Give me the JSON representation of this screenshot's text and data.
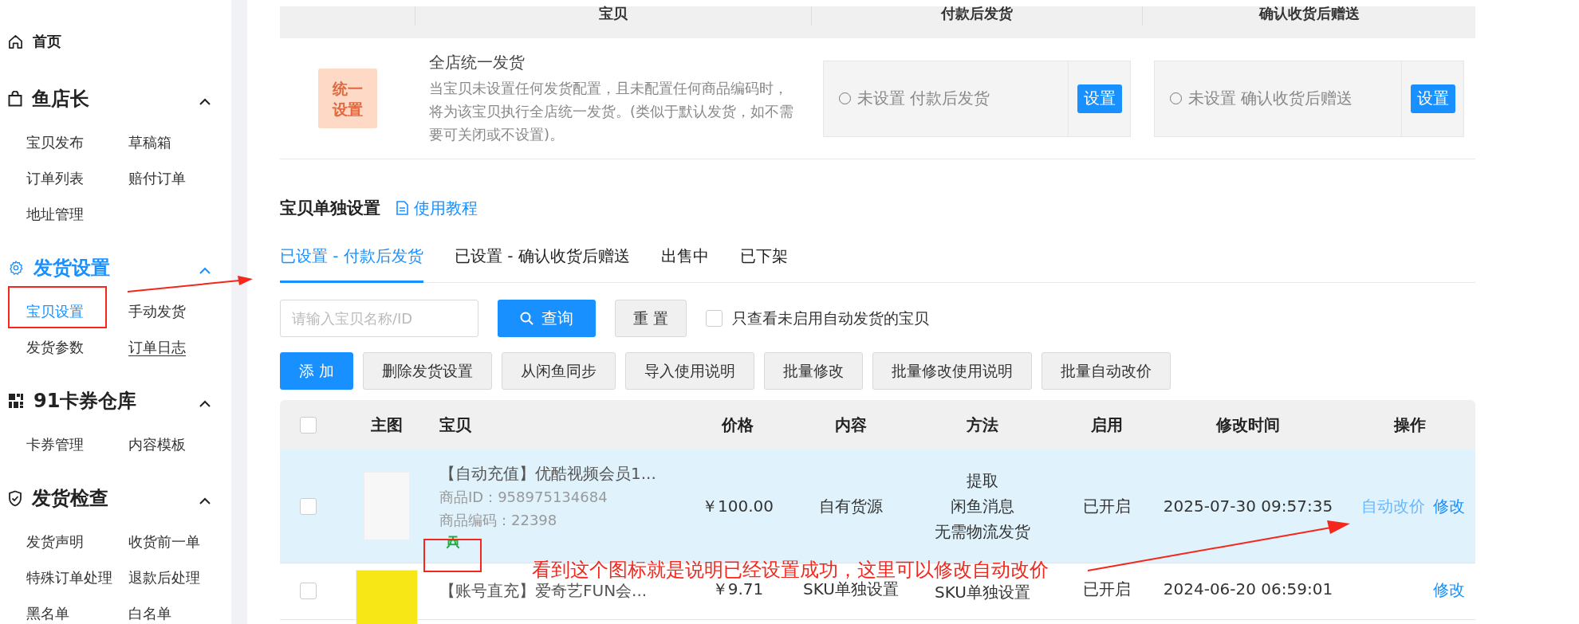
{
  "sidebar": {
    "home": {
      "label": "首页"
    },
    "groups": [
      {
        "title": "鱼店长",
        "active": false,
        "expanded": true,
        "items": [
          {
            "label": "宝贝发布",
            "selected": false,
            "hovered": false
          },
          {
            "label": "草稿箱",
            "selected": false,
            "hovered": false
          },
          {
            "label": "订单列表",
            "selected": false,
            "hovered": false
          },
          {
            "label": "赔付订单",
            "selected": false,
            "hovered": false
          },
          {
            "label": "地址管理",
            "selected": false,
            "hovered": false
          }
        ]
      },
      {
        "title": "发货设置",
        "active": true,
        "expanded": true,
        "items": [
          {
            "label": "宝贝设置",
            "selected": true,
            "hovered": false
          },
          {
            "label": "手动发货",
            "selected": false,
            "hovered": false
          },
          {
            "label": "发货参数",
            "selected": false,
            "hovered": false
          },
          {
            "label": "订单日志",
            "selected": false,
            "hovered": true
          }
        ]
      },
      {
        "title": "91卡券仓库",
        "active": false,
        "expanded": true,
        "items": [
          {
            "label": "卡券管理",
            "selected": false,
            "hovered": false
          },
          {
            "label": "内容模板",
            "selected": false,
            "hovered": false
          }
        ]
      },
      {
        "title": "发货检查",
        "active": false,
        "expanded": true,
        "items": [
          {
            "label": "发货声明",
            "selected": false,
            "hovered": false
          },
          {
            "label": "收货前一单",
            "selected": false,
            "hovered": false
          },
          {
            "label": "特殊订单处理",
            "selected": false,
            "hovered": false
          },
          {
            "label": "退款后处理",
            "selected": false,
            "hovered": false
          },
          {
            "label": "黑名单",
            "selected": false,
            "hovered": false
          },
          {
            "label": "白名单",
            "selected": false,
            "hovered": false
          }
        ]
      }
    ]
  },
  "global_setting": {
    "columns": [
      "宝贝",
      "付款后发货",
      "确认收货后赠送"
    ],
    "badge": "统一设置",
    "title": "全店统一发货",
    "description": "当宝贝未设置任何发货配置，且未配置任何商品编码时，将为该宝贝执行全店统一发货。(类似于默认发货，如不需要可关闭或不设置)。",
    "options": [
      {
        "text": "未设置 付款后发货",
        "checked": false,
        "button": "设置"
      },
      {
        "text": "未设置 确认收货后赠送",
        "checked": false,
        "button": "设置"
      }
    ]
  },
  "section": {
    "title": "宝贝单独设置",
    "help_link": "使用教程"
  },
  "tabs": [
    {
      "label": "已设置 - 付款后发货",
      "selected": true
    },
    {
      "label": "已设置 - 确认收货后赠送",
      "selected": false
    },
    {
      "label": "出售中",
      "selected": false
    },
    {
      "label": "已下架",
      "selected": false
    }
  ],
  "filter": {
    "placeholder": "请输入宝贝名称/ID",
    "query_button": "查询",
    "reset_button": "重 置",
    "only_disabled": {
      "label": "只查看未启用自动发货的宝贝",
      "checked": false
    }
  },
  "actions": [
    {
      "label": "添 加",
      "primary": true
    },
    {
      "label": "删除发货设置",
      "primary": false
    },
    {
      "label": "从闲鱼同步",
      "primary": false
    },
    {
      "label": "导入使用说明",
      "primary": false
    },
    {
      "label": "批量修改",
      "primary": false
    },
    {
      "label": "批量修改使用说明",
      "primary": false
    },
    {
      "label": "批量自动改价",
      "primary": false
    }
  ],
  "table": {
    "select_all": false,
    "columns": [
      "主图",
      "宝贝",
      "价格",
      "内容",
      "方法",
      "启用",
      "修改时间",
      "操作"
    ],
    "rows": [
      {
        "highlighted": true,
        "checked": false,
        "title": "【自动充值】优酷视频会员1...",
        "id_line": "商品ID：958975134684",
        "code_line": "商品编码：22398",
        "auto_price": true,
        "price": "￥100.00",
        "content": "自有货源",
        "method": [
          "提取",
          "闲鱼消息",
          "无需物流发货"
        ],
        "enabled": "已开启",
        "time": "2025-07-30 09:57:35",
        "ops": [
          {
            "label": "自动改价",
            "hovered": true
          },
          {
            "label": "修改",
            "hovered": false
          }
        ]
      },
      {
        "highlighted": false,
        "checked": false,
        "title": "【账号直充】爱奇艺FUN会...",
        "auto_price": false,
        "price": "￥9.71",
        "content": "SKU单独设置",
        "method": [
          "SKU单独设置"
        ],
        "enabled": "已开启",
        "time": "2024-06-20 06:59:01",
        "ops": [
          {
            "label": "修改",
            "hovered": false
          }
        ]
      }
    ]
  },
  "annotation": {
    "note": "看到这个图标就是说明已经设置成功，这里可以修改自动改价"
  }
}
